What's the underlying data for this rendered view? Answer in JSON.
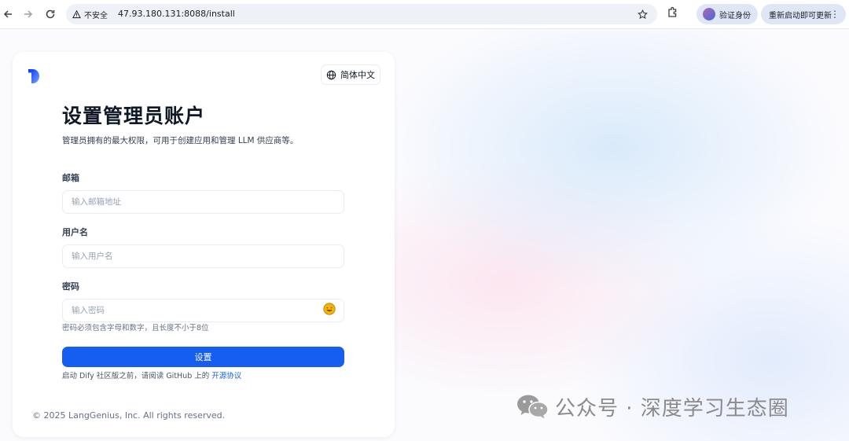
{
  "browser": {
    "back_icon": "arrow-left-icon",
    "forward_icon": "arrow-right-icon",
    "reload_icon": "reload-icon",
    "security_label": "不安全",
    "url": "47.93.180.131:8088/install",
    "verify_label": "验证身份",
    "restart_label": "重新启动即可更新"
  },
  "card": {
    "language_label": "简体中文",
    "title": "设置管理员账户",
    "subtitle": "管理员拥有的最大权限，可用于创建应用和管理 LLM 供应商等。",
    "email": {
      "label": "邮箱",
      "placeholder": "输入邮箱地址",
      "value": ""
    },
    "username": {
      "label": "用户名",
      "placeholder": "输入用户名",
      "value": ""
    },
    "password": {
      "label": "密码",
      "placeholder": "输入密码",
      "value": "",
      "hint": "密码必须包含字母和数字，且长度不小于8位"
    },
    "submit_label": "设置",
    "agreement_prefix": "启动 Dify 社区版之前，请阅读 GitHub 上的",
    "agreement_link": "开源协议",
    "copyright": "© 2025 LangGenius, Inc. All rights reserved."
  },
  "watermark": {
    "text": "公众号 · 深度学习生态圈"
  },
  "colors": {
    "primary": "#155eef",
    "title": "#101828",
    "muted": "#667085"
  }
}
